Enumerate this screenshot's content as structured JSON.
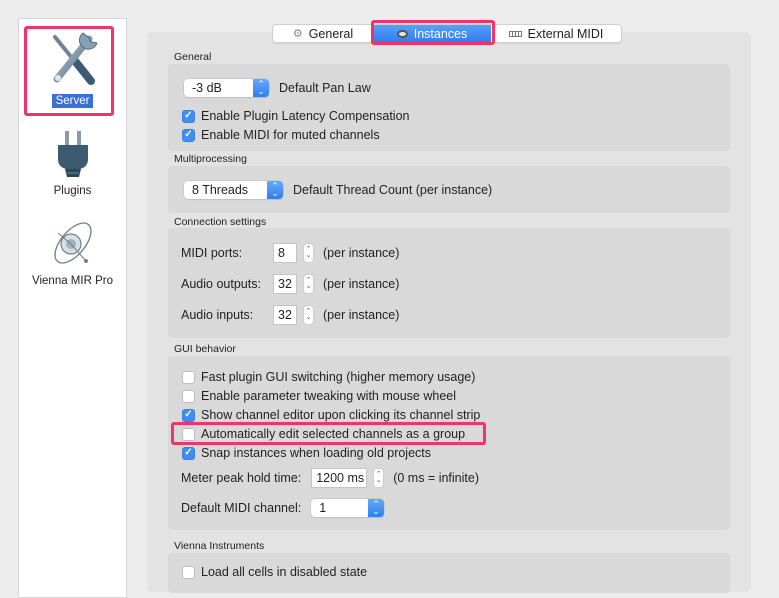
{
  "sidebar": {
    "items": [
      {
        "label": "Server",
        "icon": "tools-icon",
        "selected": true
      },
      {
        "label": "Plugins",
        "icon": "plug-icon",
        "selected": false
      },
      {
        "label": "Vienna MIR Pro",
        "icon": "orbit-icon",
        "selected": false
      }
    ]
  },
  "tabs": [
    {
      "label": "General",
      "icon": "gear-icon",
      "active": false
    },
    {
      "label": "Instances",
      "icon": "instance-icon",
      "active": true
    },
    {
      "label": "External MIDI",
      "icon": "midi-keyboard-icon",
      "active": false
    }
  ],
  "general": {
    "title": "General",
    "pan_law": {
      "value": "-3 dB",
      "label": "Default Pan Law"
    },
    "latency_comp": {
      "label": "Enable Plugin Latency Compensation",
      "checked": true
    },
    "midi_muted": {
      "label": "Enable MIDI for muted channels",
      "checked": true
    }
  },
  "multiprocessing": {
    "title": "Multiprocessing",
    "threads": {
      "value": "8 Threads",
      "label": "Default Thread Count (per instance)"
    }
  },
  "connection": {
    "title": "Connection settings",
    "rows": [
      {
        "label": "MIDI ports:",
        "value": "8",
        "suffix": "(per instance)"
      },
      {
        "label": "Audio outputs:",
        "value": "32",
        "suffix": "(per instance)"
      },
      {
        "label": "Audio inputs:",
        "value": "32",
        "suffix": "(per instance)"
      }
    ]
  },
  "gui": {
    "title": "GUI behavior",
    "options": [
      {
        "label": "Fast plugin GUI switching (higher memory usage)",
        "checked": false
      },
      {
        "label": "Enable parameter tweaking with mouse wheel",
        "checked": false
      },
      {
        "label": "Show channel editor upon clicking its channel strip",
        "checked": true
      },
      {
        "label": "Automatically edit selected channels as a group",
        "checked": false
      },
      {
        "label": "Snap instances when loading old projects",
        "checked": true
      }
    ],
    "meter_peak": {
      "label": "Meter peak hold time:",
      "value": "1200 ms",
      "suffix": "(0 ms = infinite)"
    },
    "midi_channel": {
      "label": "Default MIDI channel:",
      "value": "1"
    }
  },
  "vienna_instruments": {
    "title": "Vienna Instruments",
    "load_disabled": {
      "label": "Load all cells in disabled state",
      "checked": false
    }
  },
  "colors": {
    "highlight": "#f0336b",
    "accent": "#2f7ef0",
    "selection": "#3a70d6"
  }
}
